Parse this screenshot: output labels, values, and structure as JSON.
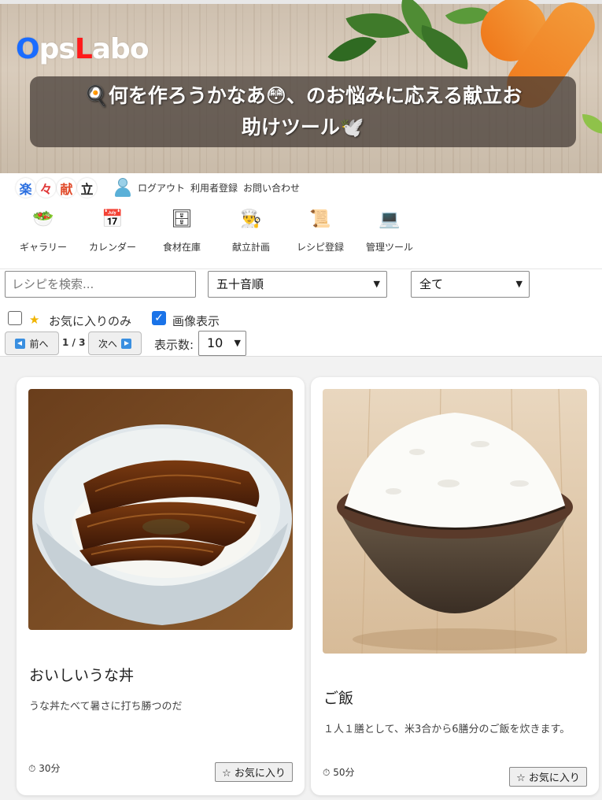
{
  "banner": {
    "logo": {
      "part1": "O",
      "part2": "ps",
      "part3": "L",
      "part4": "abo"
    },
    "hero_line1": "🍳何を作ろうかなあ😳、のお悩みに応える献立お",
    "hero_line2": "助けツール🕊️"
  },
  "header": {
    "brand_chars": [
      "楽",
      "々",
      "献",
      "立"
    ],
    "brand_colors": [
      "#2b6fe0",
      "#e03a3a",
      "#e04a2a",
      "#222222"
    ],
    "links": [
      "ログアウト",
      "利用者登録",
      "お問い合わせ"
    ],
    "nav": [
      {
        "label": "ギャラリー",
        "icon": "🥗",
        "icon_name": "salad-bowl-icon"
      },
      {
        "label": "カレンダー",
        "icon": "📅",
        "icon_name": "calendar-icon"
      },
      {
        "label": "食材在庫",
        "icon": "🗄",
        "icon_name": "cabinet-icon"
      },
      {
        "label": "献立計画",
        "icon": "👨‍🍳",
        "icon_name": "chef-icon"
      },
      {
        "label": "レシピ登録",
        "icon": "📜",
        "icon_name": "scroll-icon"
      },
      {
        "label": "管理ツール",
        "icon": "💻",
        "icon_name": "laptop-icon"
      }
    ]
  },
  "controls": {
    "search_placeholder": "レシピを検索...",
    "sort_value": "五十音順",
    "filter_value": "全て",
    "favorites_only_label": "お気に入りのみ",
    "favorites_only_checked": false,
    "show_images_label": "画像表示",
    "show_images_checked": true,
    "prev_label": "前へ",
    "page": "1 / 3",
    "next_label": "次へ",
    "per_page_label": "表示数:",
    "per_page_value": "10"
  },
  "recipes": [
    {
      "title": "おいしいうな丼",
      "description": "うな丼たべて暑さに打ち勝つのだ",
      "time": "30分",
      "fav_label": "☆ お気に入り"
    },
    {
      "title": "ご飯",
      "description": "１人１膳として、米3合から6膳分のご飯を炊きます。",
      "time": "50分",
      "fav_label": "☆ お気に入り"
    }
  ]
}
